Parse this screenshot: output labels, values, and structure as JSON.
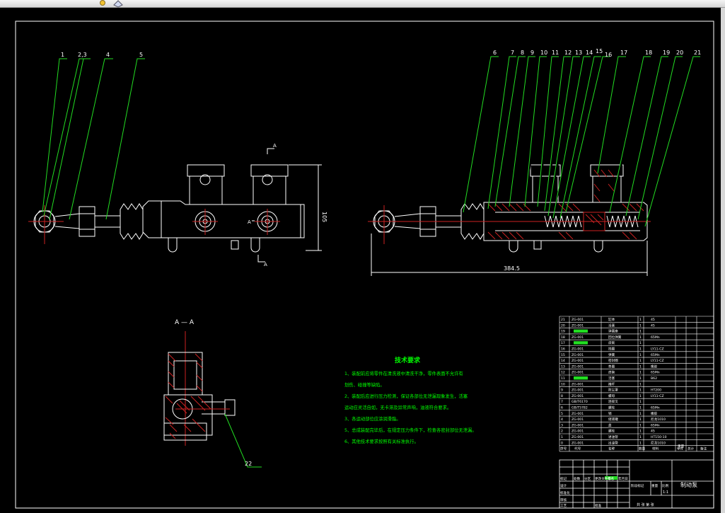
{
  "toolbar": {
    "icons": [
      "zoom-icon",
      "view-icon"
    ]
  },
  "balloons": {
    "b1": "1",
    "b23": "2,3",
    "b4": "4",
    "b5": "5",
    "b6": "6",
    "b7": "7",
    "b8": "8",
    "b9": "9",
    "b10": "10",
    "b11": "11",
    "b12": "12",
    "b13": "13",
    "b14": "14",
    "b15": "15",
    "b16": "16",
    "b17": "17",
    "b18": "18",
    "b19": "19",
    "b20": "20",
    "b21": "21",
    "b22": "22"
  },
  "dimensions": {
    "height": "105",
    "length": "384.5"
  },
  "section": {
    "label": "A — A",
    "mark": "A"
  },
  "tech": {
    "title": "技术要求",
    "lines": [
      "1、装配前应将零件在清洗液中清洗干净，零件表面不允许有",
      "划伤、碰撞等缺陷。",
      "2、装配后应进行压力检测，保证各部位无泄漏现象发生，活塞",
      "运动应灵活自如，无卡滞及异常声响，油液符合要求。",
      "3、各运动部位应涂润滑脂。",
      "5、总成装配完毕后，在规定压力条件下，检查各密封部位无泄漏。",
      "6、其他技术要求按照有关标准执行。"
    ]
  },
  "bom": {
    "rows": [
      {
        "no": "21",
        "code": "ZG-001",
        "name": "缸体",
        "qty": "1",
        "mat": "45"
      },
      {
        "no": "20",
        "code": "ZG-001",
        "name": "活塞",
        "qty": "1",
        "mat": "45"
      },
      {
        "no": "19",
        "code": "",
        "name": "弹簧座",
        "qty": "1",
        "mat": ""
      },
      {
        "no": "18",
        "code": "ZG-001",
        "name": "回位弹簧",
        "qty": "1",
        "mat": "65Mn"
      },
      {
        "no": "17",
        "code": "",
        "name": "皮碗",
        "qty": "1",
        "mat": ""
      },
      {
        "no": "16",
        "code": "ZG-001",
        "name": "挡圈",
        "qty": "1",
        "mat": "LY11-CZ"
      },
      {
        "no": "15",
        "code": "ZG-001",
        "name": "弹簧",
        "qty": "1",
        "mat": "65Mn"
      },
      {
        "no": "14",
        "code": "ZG-001",
        "name": "密封圈",
        "qty": "1",
        "mat": "LY11-CZ"
      },
      {
        "no": "13",
        "code": "ZG-001",
        "name": "垫圈",
        "qty": "1",
        "mat": "橡胶"
      },
      {
        "no": "12",
        "code": "ZG-001",
        "name": "皮碗",
        "qty": "1",
        "mat": "65Mn"
      },
      {
        "no": "11",
        "code": "",
        "name": "活塞",
        "qty": "1",
        "mat": "B62"
      },
      {
        "no": "10",
        "code": "ZG-001",
        "name": "推杆",
        "qty": "1",
        "mat": ""
      },
      {
        "no": "9",
        "code": "ZG-001",
        "name": "防尘罩",
        "qty": "1",
        "mat": "HT200"
      },
      {
        "no": "8",
        "code": "ZG-001",
        "name": "螺母",
        "qty": "1",
        "mat": "LY11-CZ"
      },
      {
        "no": "7",
        "code": "GB/T6170",
        "name": "连接叉",
        "qty": "1",
        "mat": ""
      },
      {
        "no": "6",
        "code": "GB/T5782",
        "name": "螺栓",
        "qty": "1",
        "mat": "65Mn"
      },
      {
        "no": "5",
        "code": "ZG-001",
        "name": "销",
        "qty": "1",
        "mat": "橡胶"
      },
      {
        "no": "4",
        "code": "ZG-001",
        "name": "储液罐",
        "qty": "1",
        "mat": "尼龙1010"
      },
      {
        "no": "3",
        "code": "ZG-001",
        "name": "盖",
        "qty": "1",
        "mat": "65Mn"
      },
      {
        "no": "2",
        "code": "ZG-001",
        "name": "螺栓",
        "qty": "1",
        "mat": "45"
      },
      {
        "no": "1",
        "code": "ZG-001",
        "name": "进油管",
        "qty": "1",
        "mat": "HT150-10"
      },
      {
        "no": "0",
        "code": "ZG-001",
        "name": "出油管",
        "qty": "1",
        "mat": "尼龙1010"
      }
    ],
    "header": [
      "序号",
      "代号",
      "名称",
      "数量",
      "材料",
      "单件",
      "总计",
      "备注"
    ],
    "weight": "重量"
  },
  "titleblock": {
    "title": "制动泵",
    "scale": "1:1",
    "sheet": "共 张 第 张",
    "labels": [
      "标记",
      "处数",
      "分区",
      "更改文件号",
      "签名",
      "年月日",
      "设计",
      "标准化",
      "阶段标记",
      "重量",
      "比例",
      "审核",
      "工艺",
      "批准"
    ]
  },
  "colors": {
    "frame": "#ffffff",
    "leader": "#22dd22",
    "text": "#ffffff",
    "part": "#ffffff",
    "section": "#cc2222",
    "tech": "#00ff00"
  }
}
